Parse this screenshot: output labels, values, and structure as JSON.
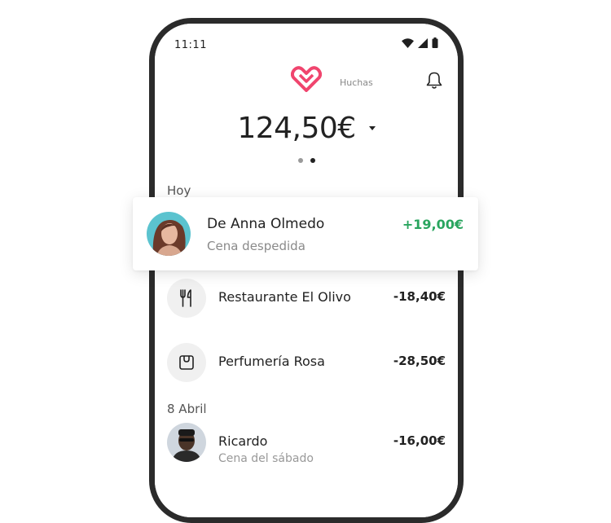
{
  "status_bar": {
    "time": "11:11",
    "icons": [
      "wifi-icon",
      "signal-icon",
      "battery-icon"
    ]
  },
  "header": {
    "logo": "heart-logo-icon",
    "tab_label": "Huchas",
    "notification": "bell-icon"
  },
  "balance": {
    "amount": "124,50€"
  },
  "pager": {
    "count": 2,
    "active": 1
  },
  "sections": {
    "today": "Hoy",
    "april": "8 Abril"
  },
  "highlight": {
    "title": "De Anna Olmedo",
    "subtitle": "Cena despedida",
    "amount": "+19,00€"
  },
  "transactions": [
    {
      "icon": "cutlery-icon",
      "title": "Restaurante El Olivo",
      "amount": "-18,40€"
    },
    {
      "icon": "shopping-bag-icon",
      "title": "Perfumería Rosa",
      "amount": "-28,50€"
    }
  ],
  "april_transactions": [
    {
      "icon": "avatar",
      "title": "Ricardo",
      "subtitle": "Cena del sábado",
      "amount": "-16,00€"
    }
  ],
  "colors": {
    "brand": "#f0456e",
    "positive": "#2aa55f",
    "phone_frame": "#2b2b2b"
  }
}
